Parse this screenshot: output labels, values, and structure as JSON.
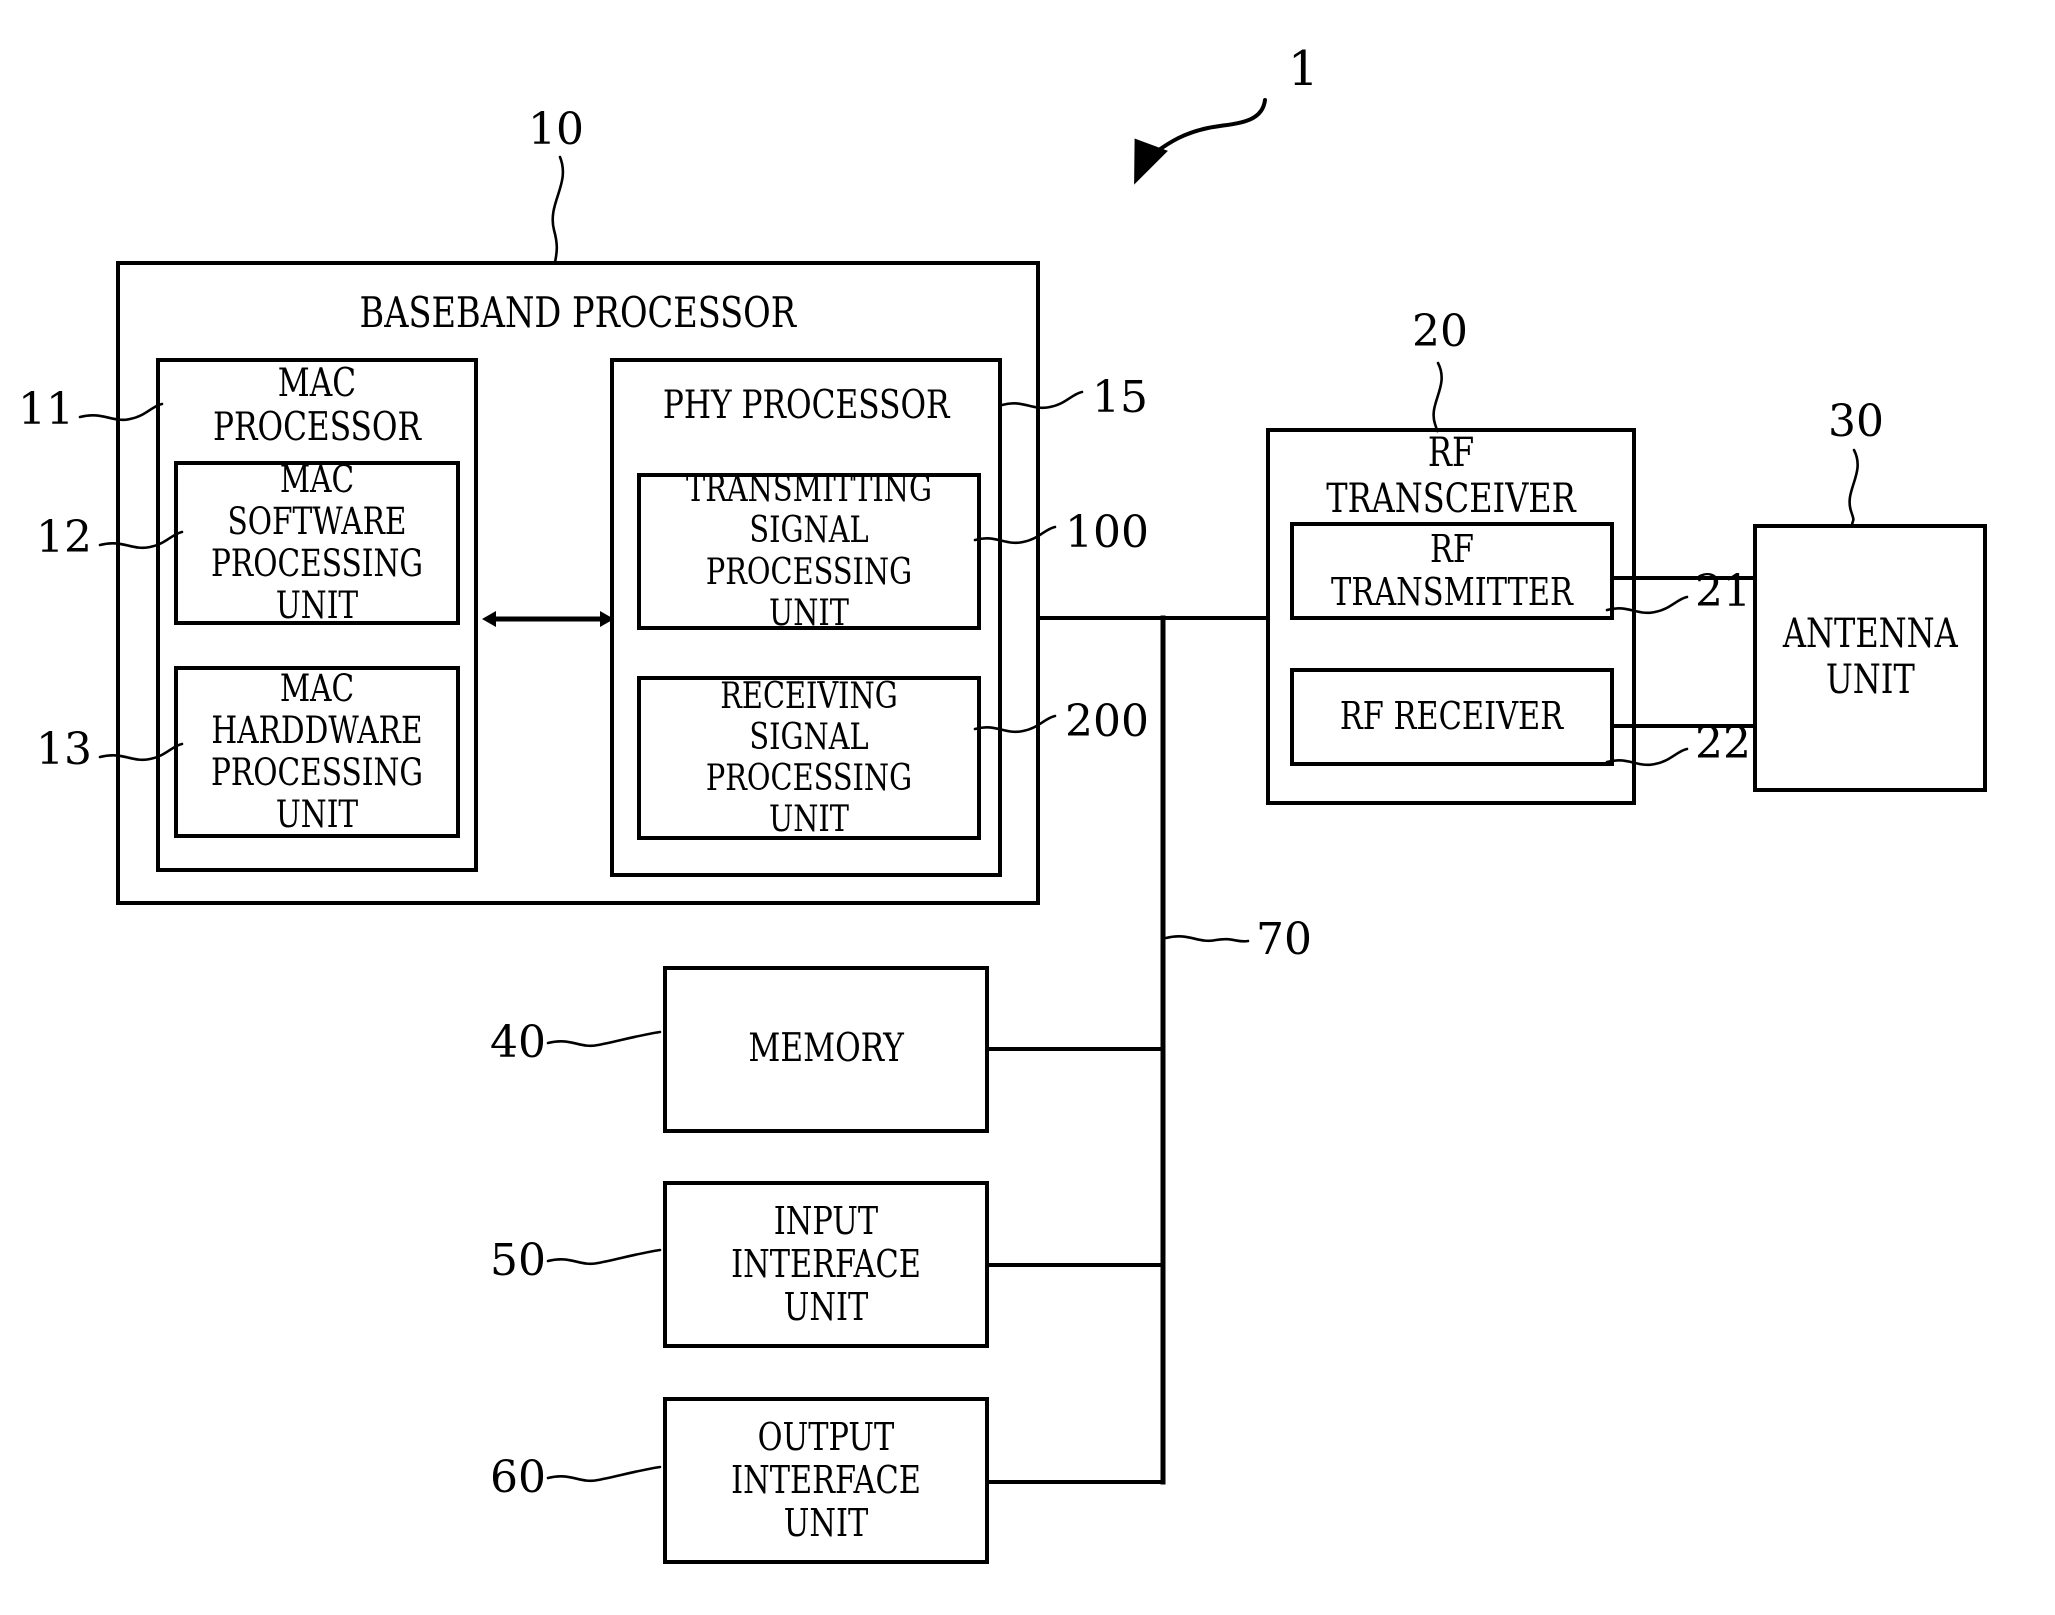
{
  "figure": {
    "type": "patent-block-diagram",
    "overall_label": "1"
  },
  "blocks": {
    "baseband_processor": {
      "label": "BASEBAND PROCESSOR",
      "ref": "10"
    },
    "mac_processor": {
      "label": "MAC PROCESSOR",
      "ref": "11"
    },
    "mac_software_processing_unit": {
      "label": "MAC SOFTWARE\nPROCESSING\nUNIT",
      "ref": "12"
    },
    "mac_hardware_processing_unit": {
      "label": "MAC HARDDWARE\nPROCESSING\nUNIT",
      "ref": "13"
    },
    "phy_processor": {
      "label": "PHY PROCESSOR",
      "ref": "15"
    },
    "transmitting_signal_processing_unit": {
      "label": "TRANSMITTING\nSIGNAL\nPROCESSING UNIT",
      "ref": "100"
    },
    "receiving_signal_processing_unit": {
      "label": "RECEIVING\nSIGNAL\nPROCESSING UNIT",
      "ref": "200"
    },
    "rf_transceiver": {
      "label": "RF TRANSCEIVER",
      "ref": "20"
    },
    "rf_transmitter": {
      "label": "RF TRANSMITTER",
      "ref": "21"
    },
    "rf_receiver": {
      "label": "RF RECEIVER",
      "ref": "22"
    },
    "antenna_unit": {
      "label": "ANTENNA\nUNIT",
      "ref": "30"
    },
    "memory": {
      "label": "MEMORY",
      "ref": "40"
    },
    "input_interface_unit": {
      "label": "INPUT\nINTERFACE UNIT",
      "ref": "50"
    },
    "output_interface_unit": {
      "label": "OUTPUT\nINTERFACE UNIT",
      "ref": "60"
    },
    "system_bus": {
      "label": "",
      "ref": "70"
    }
  },
  "ref_numbers": [
    "1",
    "10",
    "11",
    "12",
    "13",
    "15",
    "100",
    "200",
    "20",
    "21",
    "22",
    "30",
    "40",
    "50",
    "60",
    "70"
  ],
  "colors": {
    "line": "#000000",
    "background": "#ffffff",
    "text": "#000000"
  }
}
